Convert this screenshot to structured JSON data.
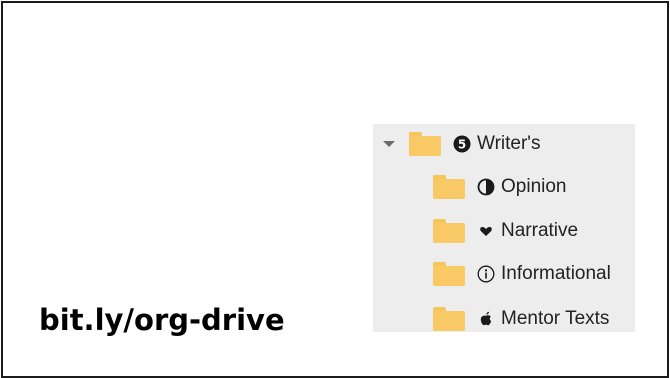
{
  "slide": {
    "url_text": "bit.ly/org-drive"
  },
  "folder_tree": {
    "items": [
      {
        "label": "Writer's",
        "badge": "5",
        "icon": "circled-number-icon",
        "expanded": true
      },
      {
        "label": "Opinion",
        "icon": "half-circle-icon"
      },
      {
        "label": "Narrative",
        "icon": "heart-icon"
      },
      {
        "label": "Informational",
        "icon": "info-circle-icon"
      },
      {
        "label": "Mentor Texts",
        "icon": "apple-icon"
      }
    ]
  },
  "colors": {
    "folder": "#f8c964",
    "panel_bg": "#ededed",
    "frame": "#1b1b1b"
  }
}
